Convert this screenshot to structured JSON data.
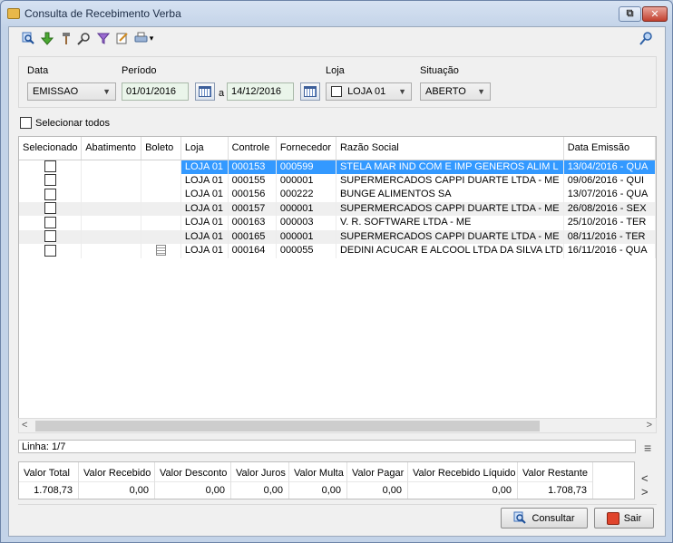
{
  "window": {
    "title": "Consulta de Recebimento Verba",
    "restore_glyph": "⧉",
    "close_glyph": "✕"
  },
  "toolbar": {
    "icons": [
      "search-icon",
      "download-arrow-icon",
      "tools-icon",
      "binoculars-icon",
      "filter-icon",
      "edit-icon",
      "print-icon"
    ],
    "dropdown_glyph": "▾",
    "right_icon": "key-search-icon"
  },
  "filters": {
    "data_label": "Data",
    "data_value": "EMISSAO",
    "periodo_label": "Período",
    "date_from": "01/01/2016",
    "date_sep": "a",
    "date_to": "14/12/2016",
    "loja_label": "Loja",
    "loja_value": "LOJA 01",
    "situacao_label": "Situação",
    "situacao_value": "ABERTO"
  },
  "select_all_label": "Selecionar todos",
  "grid": {
    "columns": [
      "Selecionado",
      "Abatimento",
      "Boleto",
      "Loja",
      "Controle",
      "Fornecedor",
      "Razão Social",
      "Data Emissão"
    ],
    "rows": [
      {
        "loja": "LOJA 01",
        "controle": "000153",
        "fornecedor": "000599",
        "razao": "STELA MAR IND COM E IMP GENEROS ALIM L",
        "data": "13/04/2016 - QUA",
        "boleto": false
      },
      {
        "loja": "LOJA 01",
        "controle": "000155",
        "fornecedor": "000001",
        "razao": "SUPERMERCADOS CAPPI DUARTE LTDA - ME",
        "data": "09/06/2016 - QUI",
        "boleto": false
      },
      {
        "loja": "LOJA 01",
        "controle": "000156",
        "fornecedor": "000222",
        "razao": "BUNGE ALIMENTOS SA",
        "data": "13/07/2016 - QUA",
        "boleto": false
      },
      {
        "loja": "LOJA 01",
        "controle": "000157",
        "fornecedor": "000001",
        "razao": "SUPERMERCADOS CAPPI DUARTE LTDA - ME",
        "data": "26/08/2016 - SEX",
        "boleto": false
      },
      {
        "loja": "LOJA 01",
        "controle": "000163",
        "fornecedor": "000003",
        "razao": "V. R. SOFTWARE LTDA - ME",
        "data": "25/10/2016 - TER",
        "boleto": false
      },
      {
        "loja": "LOJA 01",
        "controle": "000165",
        "fornecedor": "000001",
        "razao": "SUPERMERCADOS CAPPI DUARTE LTDA - ME",
        "data": "08/11/2016 - TER",
        "boleto": false
      },
      {
        "loja": "LOJA 01",
        "controle": "000164",
        "fornecedor": "000055",
        "razao": "DEDINI ACUCAR E ALCOOL LTDA DA SILVA LTD",
        "data": "16/11/2016 - QUA",
        "boleto": true
      }
    ]
  },
  "scroll": {
    "left": "<",
    "right": ">"
  },
  "linha_text": "Linha: 1/7",
  "totals": {
    "headers": [
      "Valor Total",
      "Valor Recebido",
      "Valor Desconto",
      "Valor Juros",
      "Valor Multa",
      "Valor Pagar",
      "Valor Recebido Líquido",
      "Valor Restante"
    ],
    "values": [
      "1.708,73",
      "0,00",
      "0,00",
      "0,00",
      "0,00",
      "0,00",
      "0,00",
      "1.708,73"
    ]
  },
  "nav": "< >",
  "buttons": {
    "consultar": "Consultar",
    "sair": "Sair"
  },
  "colors": {
    "selection": "#3399ff",
    "date_field_bg": "#eaf5ea"
  }
}
